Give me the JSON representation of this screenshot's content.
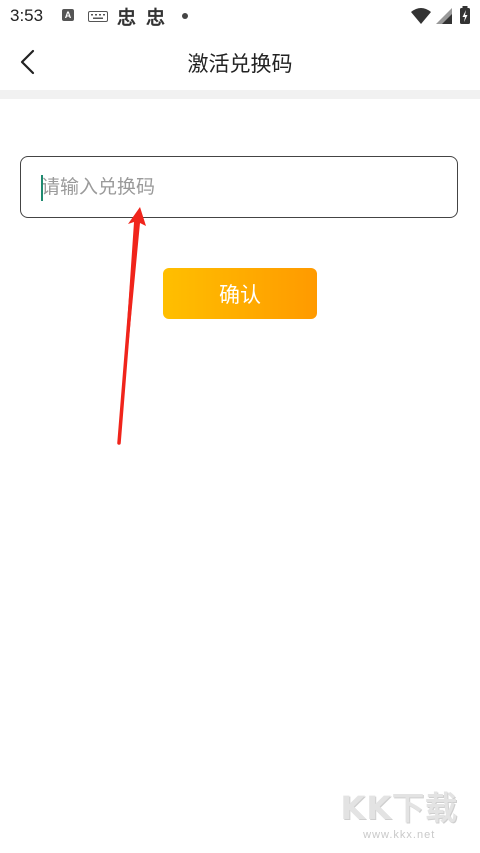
{
  "status_bar": {
    "time": "3:53",
    "icons": [
      "a-badge-icon",
      "keyboard-icon",
      "app-icon",
      "app-icon",
      "dot-icon",
      "wifi-icon",
      "signal-icon",
      "battery-icon"
    ],
    "badge_letter": "A",
    "app_glyph": "忠"
  },
  "header": {
    "title": "激活兑换码",
    "back_icon": "chevron-left-icon"
  },
  "form": {
    "code_placeholder": "请输入兑换码",
    "code_value": "",
    "confirm_label": "确认",
    "button_gradient": [
      "#ffbf00",
      "#ff9a00"
    ]
  },
  "annotation": {
    "arrow_color": "#f0241b"
  },
  "watermark": {
    "logo": "KK下载",
    "url": "www.kkx.net"
  }
}
